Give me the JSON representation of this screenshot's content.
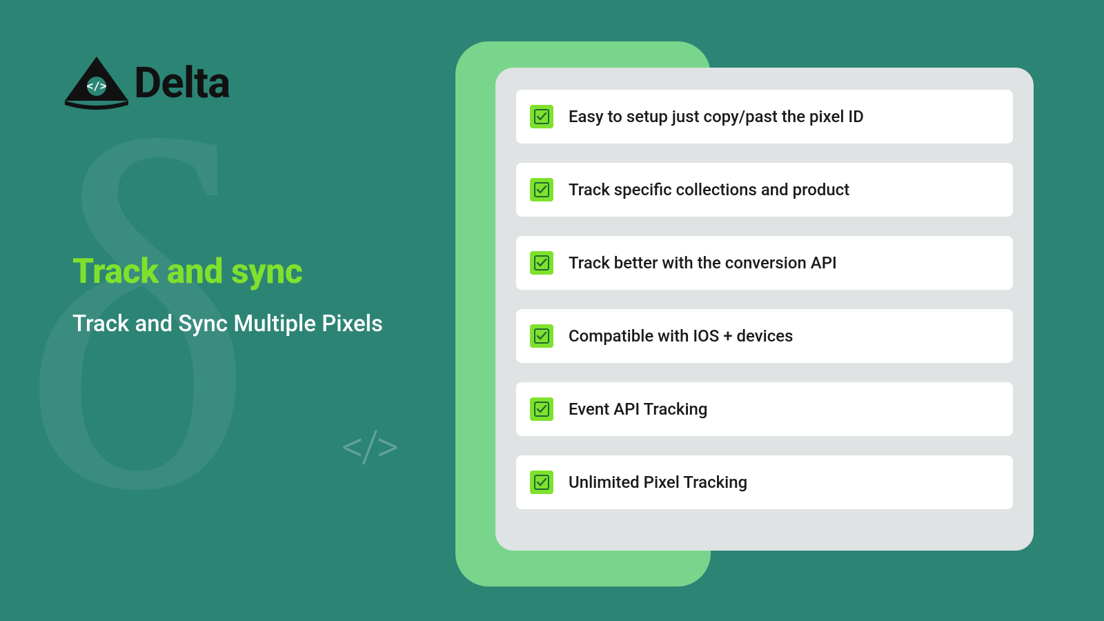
{
  "brand": {
    "name": "Delta"
  },
  "hero": {
    "headline": "Track and sync",
    "subheadline": "Track and Sync Multiple Pixels"
  },
  "features": [
    {
      "label": "Easy to setup just copy/past  the pixel ID"
    },
    {
      "label": "Track specific collections and product"
    },
    {
      "label": "Track better with the conversion API"
    },
    {
      "label": "Compatible with IOS + devices"
    },
    {
      "label": "Event API Tracking"
    },
    {
      "label": "Unlimited Pixel Tracking"
    }
  ],
  "colors": {
    "background": "#2c8475",
    "accent_green": "#80e12d",
    "card_backing": "#79d58b",
    "card_main": "#dfe3e3",
    "feature_bg": "#ffffff",
    "text_dark": "#1a1a1a"
  }
}
